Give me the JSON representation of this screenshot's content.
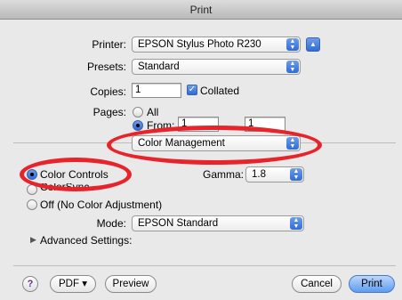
{
  "window": {
    "title": "Print"
  },
  "printer": {
    "label": "Printer:",
    "value": "EPSON Stylus Photo R230"
  },
  "presets": {
    "label": "Presets:",
    "value": "Standard"
  },
  "copies": {
    "label": "Copies:",
    "value": "1",
    "collated_label": "Collated"
  },
  "pages": {
    "label": "Pages:",
    "all_label": "All",
    "from_label": "From:",
    "from_value": "1",
    "to_value": "1"
  },
  "panel": {
    "value": "Color Management"
  },
  "color": {
    "controls_label": "Color Controls",
    "colorsync_label": "ColorSync",
    "off_label": "Off (No Color Adjustment)",
    "gamma_label": "Gamma:",
    "gamma_value": "1.8",
    "mode_label": "Mode:",
    "mode_value": "EPSON Standard",
    "advanced_label": "Advanced Settings:"
  },
  "footer": {
    "help_label": "?",
    "pdf_label": "PDF ▾",
    "preview_label": "Preview",
    "cancel_label": "Cancel",
    "print_label": "Print"
  },
  "colors": {
    "annotation": "#e8232a",
    "accent": "#2f6ad6"
  }
}
